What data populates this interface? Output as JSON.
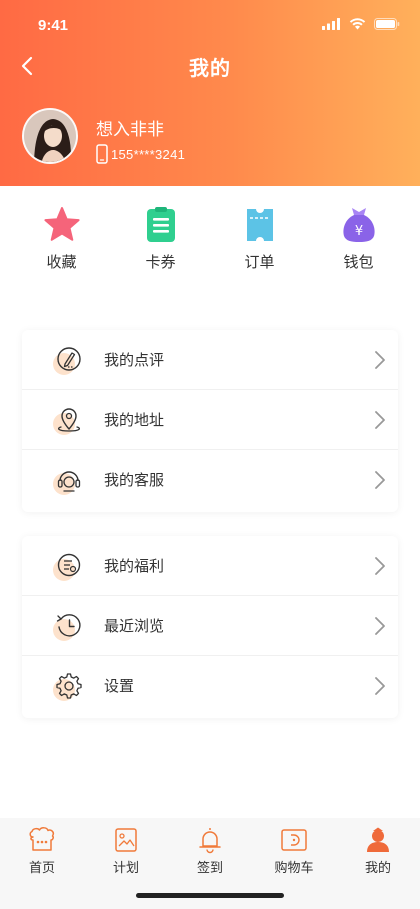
{
  "status_bar": {
    "time": "9:41"
  },
  "nav": {
    "title": "我的"
  },
  "profile": {
    "name": "想入非非",
    "phone": "155****3241"
  },
  "quick_actions": [
    {
      "label": "收藏",
      "icon": "star-icon",
      "color": "#f5647a"
    },
    {
      "label": "卡券",
      "icon": "coupon-icon",
      "color": "#2fcf8f"
    },
    {
      "label": "订单",
      "icon": "ticket-icon",
      "color": "#5cc3e6"
    },
    {
      "label": "钱包",
      "icon": "money-bag-icon",
      "color": "#8a63e8"
    }
  ],
  "menu_group_1": [
    {
      "label": "我的点评",
      "icon": "pen-icon"
    },
    {
      "label": "我的地址",
      "icon": "location-pin-icon"
    },
    {
      "label": "我的客服",
      "icon": "headset-icon"
    }
  ],
  "menu_group_2": [
    {
      "label": "我的福利",
      "icon": "benefit-icon"
    },
    {
      "label": "最近浏览",
      "icon": "history-icon"
    },
    {
      "label": "设置",
      "icon": "gear-icon"
    }
  ],
  "tab_bar": [
    {
      "label": "首页",
      "icon": "home-icon"
    },
    {
      "label": "计划",
      "icon": "plan-icon"
    },
    {
      "label": "签到",
      "icon": "bell-icon"
    },
    {
      "label": "购物车",
      "icon": "cart-icon"
    },
    {
      "label": "我的",
      "icon": "profile-icon"
    }
  ],
  "colors": {
    "accent": "#ff7a45",
    "header_start": "#ff6a44",
    "header_end": "#ffb05b",
    "icon_bg": "#fde2cc"
  }
}
